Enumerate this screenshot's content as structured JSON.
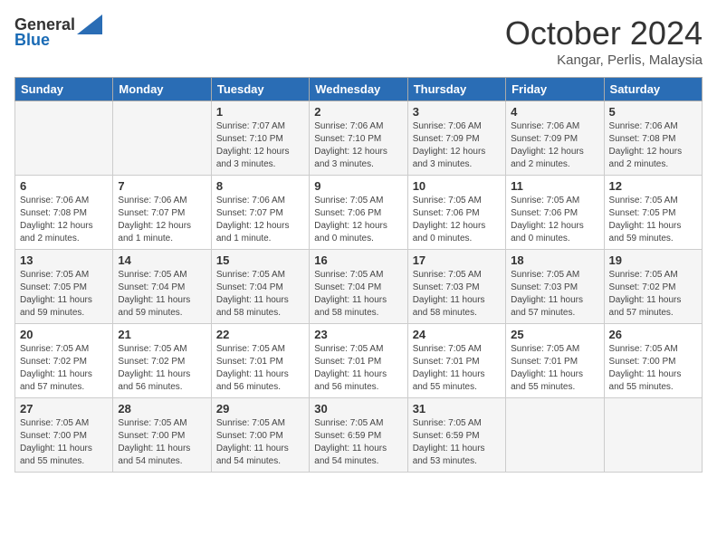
{
  "header": {
    "logo_general": "General",
    "logo_blue": "Blue",
    "month": "October 2024",
    "location": "Kangar, Perlis, Malaysia"
  },
  "days_of_week": [
    "Sunday",
    "Monday",
    "Tuesday",
    "Wednesday",
    "Thursday",
    "Friday",
    "Saturday"
  ],
  "weeks": [
    [
      {
        "day": "",
        "content": ""
      },
      {
        "day": "",
        "content": ""
      },
      {
        "day": "1",
        "content": "Sunrise: 7:07 AM\nSunset: 7:10 PM\nDaylight: 12 hours and 3 minutes."
      },
      {
        "day": "2",
        "content": "Sunrise: 7:06 AM\nSunset: 7:10 PM\nDaylight: 12 hours and 3 minutes."
      },
      {
        "day": "3",
        "content": "Sunrise: 7:06 AM\nSunset: 7:09 PM\nDaylight: 12 hours and 3 minutes."
      },
      {
        "day": "4",
        "content": "Sunrise: 7:06 AM\nSunset: 7:09 PM\nDaylight: 12 hours and 2 minutes."
      },
      {
        "day": "5",
        "content": "Sunrise: 7:06 AM\nSunset: 7:08 PM\nDaylight: 12 hours and 2 minutes."
      }
    ],
    [
      {
        "day": "6",
        "content": "Sunrise: 7:06 AM\nSunset: 7:08 PM\nDaylight: 12 hours and 2 minutes."
      },
      {
        "day": "7",
        "content": "Sunrise: 7:06 AM\nSunset: 7:07 PM\nDaylight: 12 hours and 1 minute."
      },
      {
        "day": "8",
        "content": "Sunrise: 7:06 AM\nSunset: 7:07 PM\nDaylight: 12 hours and 1 minute."
      },
      {
        "day": "9",
        "content": "Sunrise: 7:05 AM\nSunset: 7:06 PM\nDaylight: 12 hours and 0 minutes."
      },
      {
        "day": "10",
        "content": "Sunrise: 7:05 AM\nSunset: 7:06 PM\nDaylight: 12 hours and 0 minutes."
      },
      {
        "day": "11",
        "content": "Sunrise: 7:05 AM\nSunset: 7:06 PM\nDaylight: 12 hours and 0 minutes."
      },
      {
        "day": "12",
        "content": "Sunrise: 7:05 AM\nSunset: 7:05 PM\nDaylight: 11 hours and 59 minutes."
      }
    ],
    [
      {
        "day": "13",
        "content": "Sunrise: 7:05 AM\nSunset: 7:05 PM\nDaylight: 11 hours and 59 minutes."
      },
      {
        "day": "14",
        "content": "Sunrise: 7:05 AM\nSunset: 7:04 PM\nDaylight: 11 hours and 59 minutes."
      },
      {
        "day": "15",
        "content": "Sunrise: 7:05 AM\nSunset: 7:04 PM\nDaylight: 11 hours and 58 minutes."
      },
      {
        "day": "16",
        "content": "Sunrise: 7:05 AM\nSunset: 7:04 PM\nDaylight: 11 hours and 58 minutes."
      },
      {
        "day": "17",
        "content": "Sunrise: 7:05 AM\nSunset: 7:03 PM\nDaylight: 11 hours and 58 minutes."
      },
      {
        "day": "18",
        "content": "Sunrise: 7:05 AM\nSunset: 7:03 PM\nDaylight: 11 hours and 57 minutes."
      },
      {
        "day": "19",
        "content": "Sunrise: 7:05 AM\nSunset: 7:02 PM\nDaylight: 11 hours and 57 minutes."
      }
    ],
    [
      {
        "day": "20",
        "content": "Sunrise: 7:05 AM\nSunset: 7:02 PM\nDaylight: 11 hours and 57 minutes."
      },
      {
        "day": "21",
        "content": "Sunrise: 7:05 AM\nSunset: 7:02 PM\nDaylight: 11 hours and 56 minutes."
      },
      {
        "day": "22",
        "content": "Sunrise: 7:05 AM\nSunset: 7:01 PM\nDaylight: 11 hours and 56 minutes."
      },
      {
        "day": "23",
        "content": "Sunrise: 7:05 AM\nSunset: 7:01 PM\nDaylight: 11 hours and 56 minutes."
      },
      {
        "day": "24",
        "content": "Sunrise: 7:05 AM\nSunset: 7:01 PM\nDaylight: 11 hours and 55 minutes."
      },
      {
        "day": "25",
        "content": "Sunrise: 7:05 AM\nSunset: 7:01 PM\nDaylight: 11 hours and 55 minutes."
      },
      {
        "day": "26",
        "content": "Sunrise: 7:05 AM\nSunset: 7:00 PM\nDaylight: 11 hours and 55 minutes."
      }
    ],
    [
      {
        "day": "27",
        "content": "Sunrise: 7:05 AM\nSunset: 7:00 PM\nDaylight: 11 hours and 55 minutes."
      },
      {
        "day": "28",
        "content": "Sunrise: 7:05 AM\nSunset: 7:00 PM\nDaylight: 11 hours and 54 minutes."
      },
      {
        "day": "29",
        "content": "Sunrise: 7:05 AM\nSunset: 7:00 PM\nDaylight: 11 hours and 54 minutes."
      },
      {
        "day": "30",
        "content": "Sunrise: 7:05 AM\nSunset: 6:59 PM\nDaylight: 11 hours and 54 minutes."
      },
      {
        "day": "31",
        "content": "Sunrise: 7:05 AM\nSunset: 6:59 PM\nDaylight: 11 hours and 53 minutes."
      },
      {
        "day": "",
        "content": ""
      },
      {
        "day": "",
        "content": ""
      }
    ]
  ]
}
